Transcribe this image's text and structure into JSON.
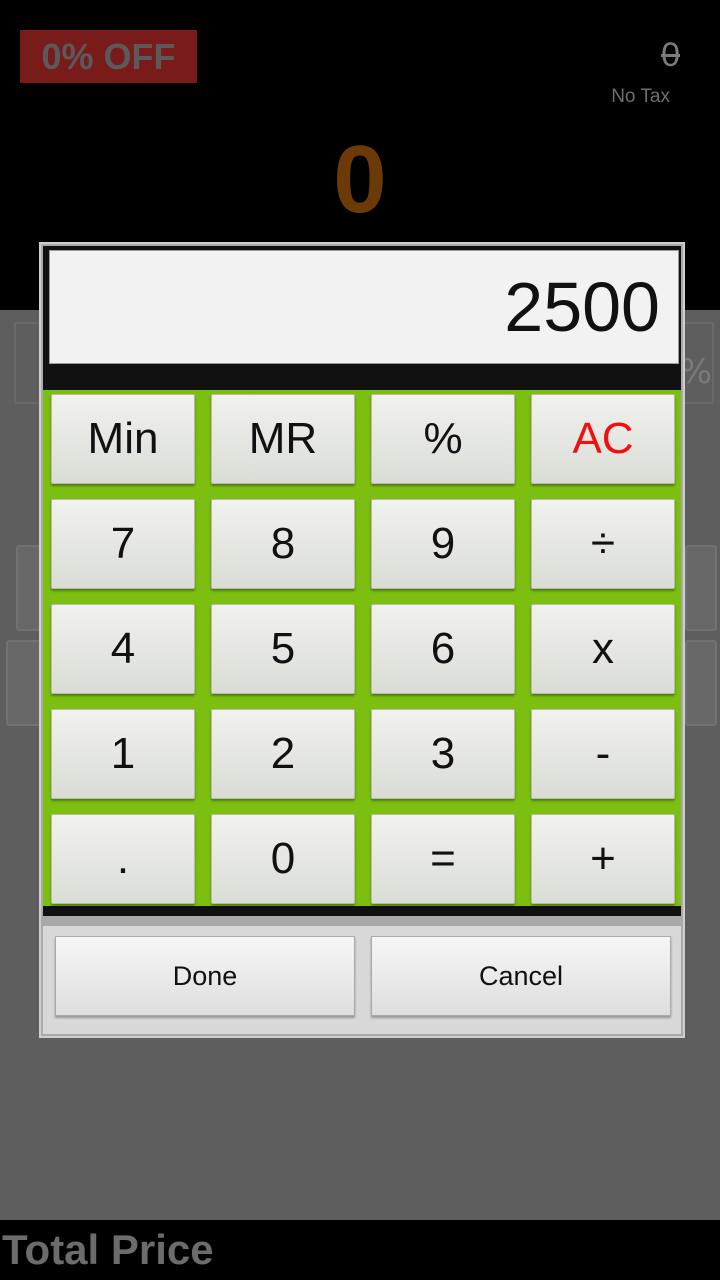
{
  "header": {
    "discount_label": "0% OFF",
    "strikethrough_value": "0",
    "tax_label": "No Tax",
    "main_value": "0"
  },
  "background": {
    "field_suffix": "%"
  },
  "footer": {
    "total_label": "Total Price"
  },
  "calculator": {
    "display_value": "2500",
    "keys": [
      [
        "Min",
        "MR",
        "%",
        "AC"
      ],
      [
        "7",
        "8",
        "9",
        "÷"
      ],
      [
        "4",
        "5",
        "6",
        "x"
      ],
      [
        "1",
        "2",
        "3",
        "-"
      ],
      [
        ".",
        "0",
        "=",
        "+"
      ]
    ],
    "done_label": "Done",
    "cancel_label": "Cancel",
    "colors": {
      "keypad_bg": "#7cbf11",
      "ac_key_text": "#ee1111",
      "main_value": "#6b3a06"
    }
  }
}
